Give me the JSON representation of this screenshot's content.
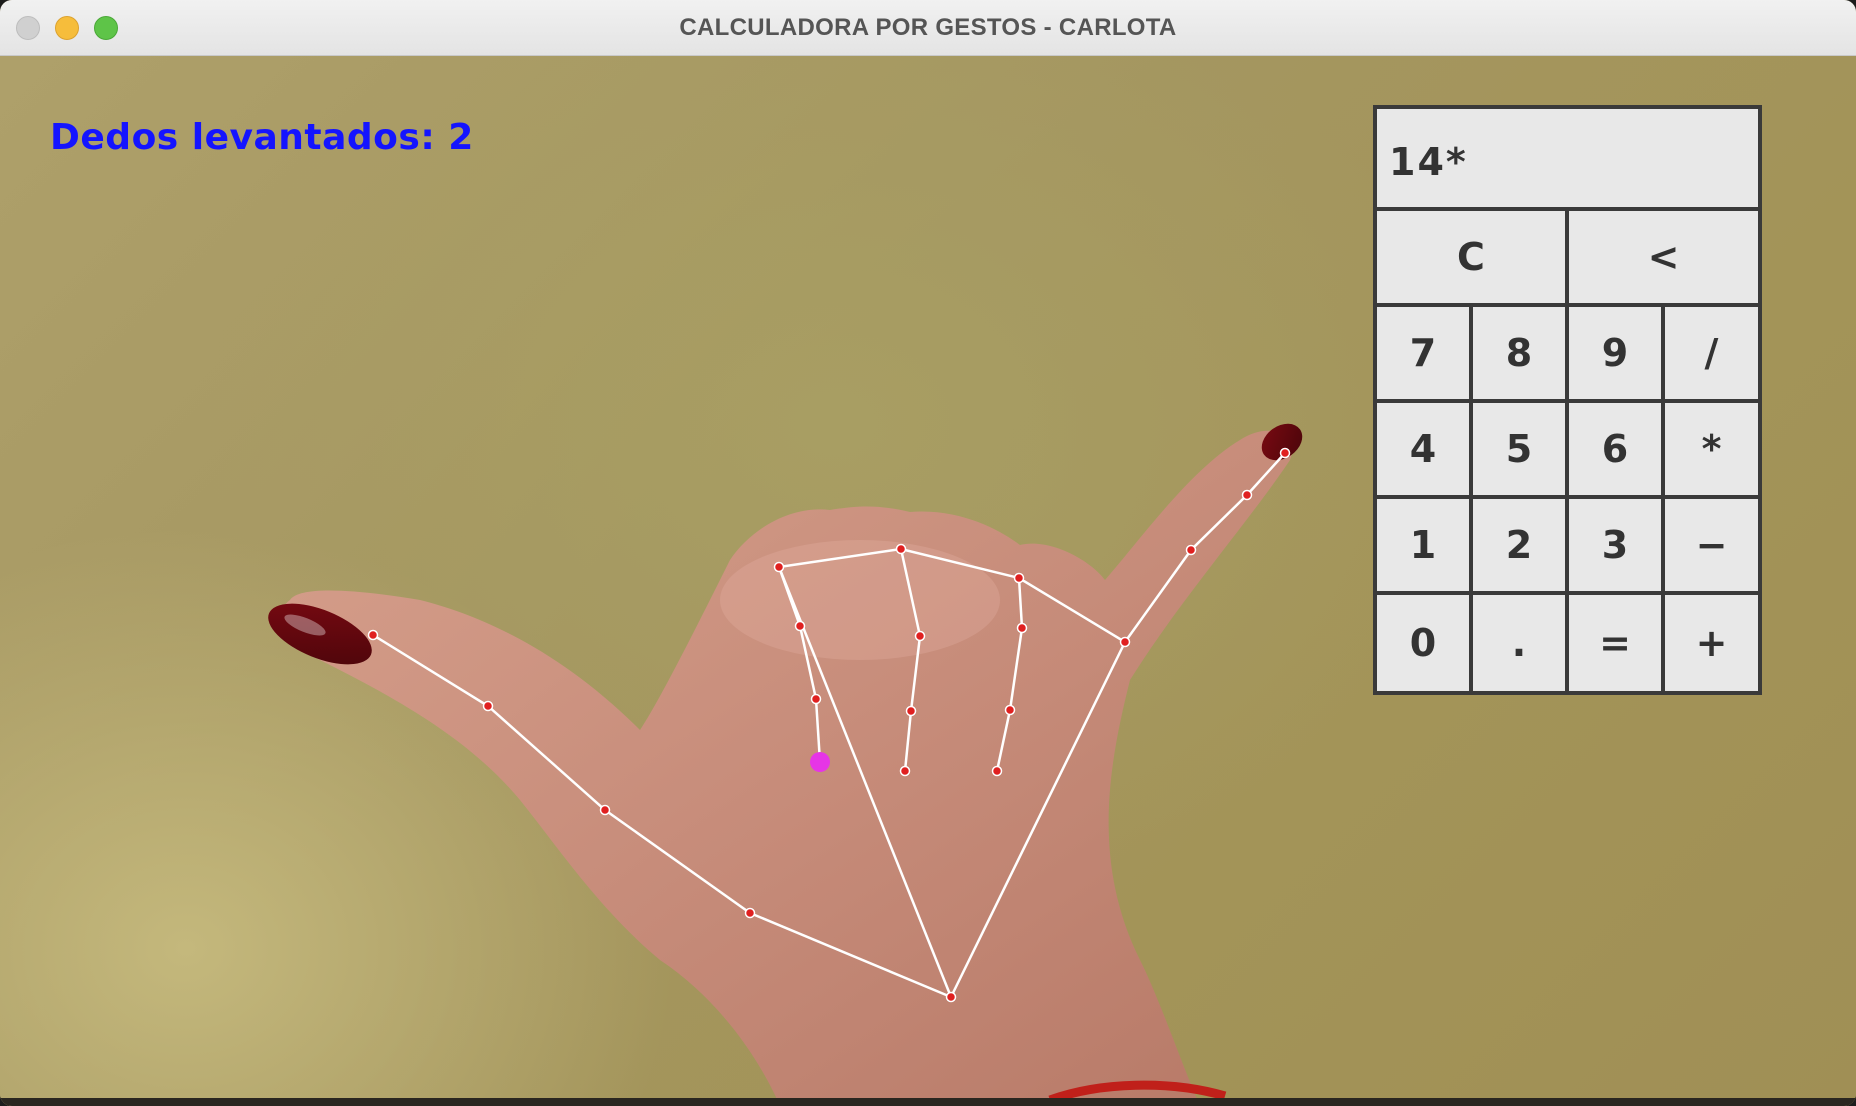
{
  "window": {
    "title": "CALCULADORA POR GESTOS - CARLOTA"
  },
  "overlay": {
    "finger_count_text": "Dedos levantados: 2",
    "text_color": "#1414ff"
  },
  "calculator": {
    "display": "14*",
    "top_keys": [
      "C",
      "<"
    ],
    "rows": [
      [
        "7",
        "8",
        "9",
        "/"
      ],
      [
        "4",
        "5",
        "6",
        "*"
      ],
      [
        "1",
        "2",
        "3",
        "−"
      ],
      [
        "0",
        ".",
        "=",
        "+"
      ]
    ]
  },
  "hand_tracking": {
    "landmark_color": "#e02020",
    "connection_color": "#ffffff",
    "pointer_color": "#e635e6"
  }
}
